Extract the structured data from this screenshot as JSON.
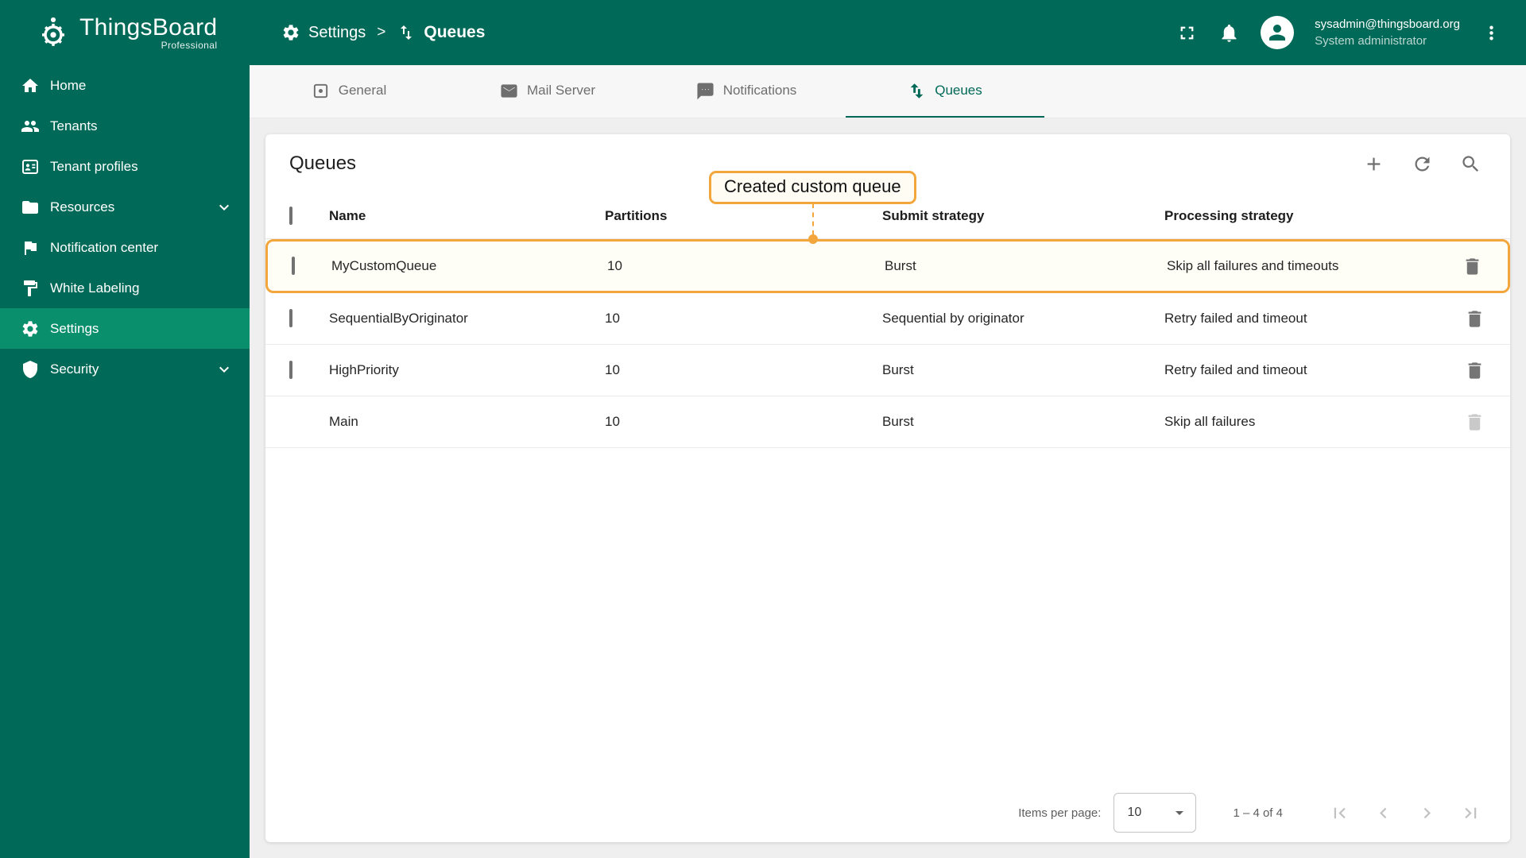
{
  "app": {
    "name": "ThingsBoard",
    "edition": "Professional"
  },
  "header": {
    "breadcrumb": {
      "parent": "Settings",
      "separator": ">",
      "current": "Queues"
    },
    "user": {
      "email": "sysadmin@thingsboard.org",
      "role": "System administrator"
    }
  },
  "sidebar": {
    "items": [
      {
        "label": "Home"
      },
      {
        "label": "Tenants"
      },
      {
        "label": "Tenant profiles"
      },
      {
        "label": "Resources"
      },
      {
        "label": "Notification center"
      },
      {
        "label": "White Labeling"
      },
      {
        "label": "Settings"
      },
      {
        "label": "Security"
      }
    ]
  },
  "tabs": [
    {
      "label": "General"
    },
    {
      "label": "Mail Server"
    },
    {
      "label": "Notifications"
    },
    {
      "label": "Queues"
    }
  ],
  "queues": {
    "title": "Queues",
    "annotation": "Created custom queue",
    "columns": {
      "name": "Name",
      "partitions": "Partitions",
      "submit": "Submit strategy",
      "processing": "Processing strategy"
    },
    "rows": [
      {
        "name": "MyCustomQueue",
        "partitions": "10",
        "submit": "Burst",
        "processing": "Skip all failures and timeouts"
      },
      {
        "name": "SequentialByOriginator",
        "partitions": "10",
        "submit": "Sequential by originator",
        "processing": "Retry failed and timeout"
      },
      {
        "name": "HighPriority",
        "partitions": "10",
        "submit": "Burst",
        "processing": "Retry failed and timeout"
      },
      {
        "name": "Main",
        "partitions": "10",
        "submit": "Burst",
        "processing": "Skip all failures"
      }
    ],
    "pagination": {
      "items_per_page_label": "Items per page:",
      "items_per_page": "10",
      "range": "1 – 4 of 4"
    }
  },
  "colors": {
    "primary_green": "#016957",
    "sidebar_active_green": "#0A8F6D",
    "annotation_orange": "#F2A63C"
  }
}
